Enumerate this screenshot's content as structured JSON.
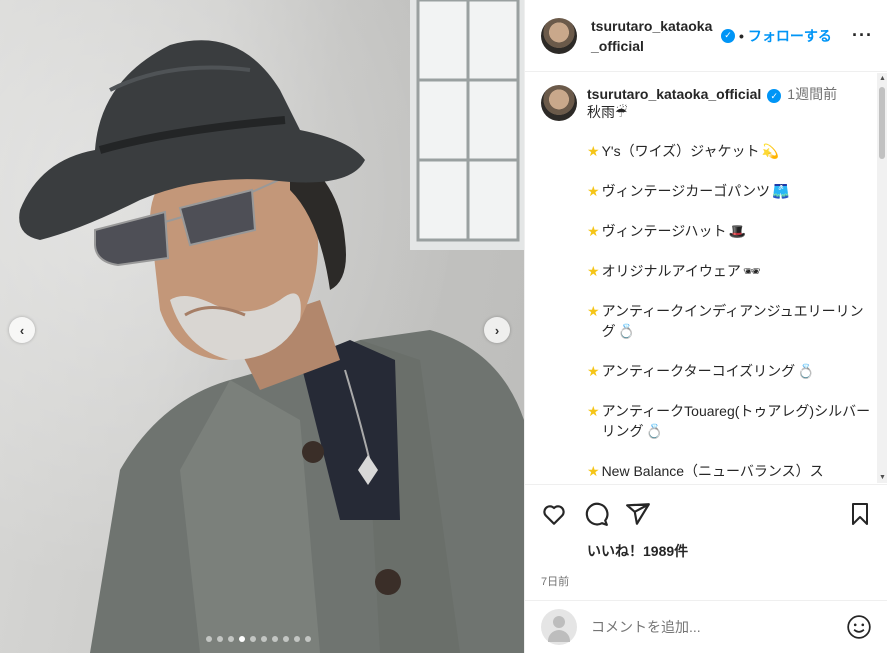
{
  "post": {
    "username_header": "tsurutaro_kataoka_official",
    "separator": "•",
    "follow_label": "フォローする",
    "more_label": "···"
  },
  "caption": {
    "username": "tsurutaro_kataoka_official",
    "time": "1週間前",
    "first_line": "秋雨☔",
    "items": [
      {
        "text": "Y's（ワイズ）ジャケット",
        "emoji": "💫"
      },
      {
        "text": "ヴィンテージカーゴパンツ",
        "emoji": "🩳"
      },
      {
        "text": "ヴィンテージハット",
        "emoji": "🎩"
      },
      {
        "text": "オリジナルアイウェア",
        "emoji": "🕶"
      },
      {
        "text": "アンティークインディアンジュエリーリング",
        "emoji": "💍"
      },
      {
        "text": "アンティークターコイズリング",
        "emoji": "💍"
      },
      {
        "text": "アンティークTouareg(トゥアレグ)シルバーリング",
        "emoji": "💍"
      },
      {
        "text": "New Balance（ニューバランス）ス",
        "emoji": ""
      }
    ]
  },
  "actions": {
    "likes": "いいね！1989件",
    "date": "7日前"
  },
  "comment": {
    "placeholder": "コメントを追加..."
  },
  "carousel": {
    "prev": "‹",
    "next": "›",
    "dot_count": 10,
    "active_dot": 3
  },
  "colors": {
    "accent": "#0095f6",
    "star": "#f5c518"
  }
}
